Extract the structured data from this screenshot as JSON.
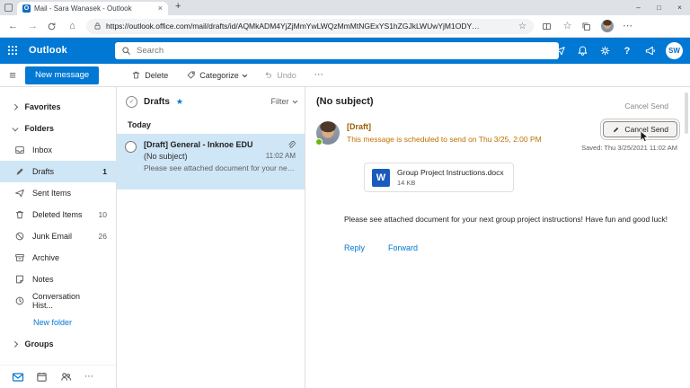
{
  "glyphs": {
    "back": "←",
    "forward": "→",
    "home": "⌂",
    "menu": "≡",
    "ellipsis": "⋯",
    "check": "✓",
    "star_filled": "★",
    "star_outline": "☆",
    "plus": "+",
    "close": "×",
    "minimize": "–",
    "maximize": "□",
    "help": "?",
    "skype_s": "S",
    "word_w": "W",
    "outlook_o": "O"
  },
  "browser": {
    "tab_title": "Mail - Sara Wanasek - Outlook",
    "url": "https://outlook.office.com/mail/drafts/id/AQMkADM4YjZjMmYwLWQzMmMtNGExYS1hZGJkLWUwYjM1ODY…"
  },
  "o365": {
    "app_name": "Outlook",
    "search_placeholder": "Search",
    "avatar_initials": "SW",
    "accent": "#0078d4"
  },
  "command_bar": {
    "new_message": "New message",
    "delete": "Delete",
    "categorize": "Categorize",
    "undo": "Undo"
  },
  "sidebar": {
    "favorites_label": "Favorites",
    "folders_label": "Folders",
    "items": [
      {
        "label": "Inbox",
        "count": ""
      },
      {
        "label": "Drafts",
        "count": "1"
      },
      {
        "label": "Sent Items",
        "count": ""
      },
      {
        "label": "Deleted Items",
        "count": "10"
      },
      {
        "label": "Junk Email",
        "count": "26"
      },
      {
        "label": "Archive",
        "count": ""
      },
      {
        "label": "Notes",
        "count": ""
      },
      {
        "label": "Conversation Hist...",
        "count": ""
      }
    ],
    "new_folder_label": "New folder",
    "groups_label": "Groups"
  },
  "message_list": {
    "title": "Drafts",
    "filter_label": "Filter",
    "today_label": "Today",
    "message": {
      "line1": "[Draft] General - Inknoe EDU",
      "subject": "(No subject)",
      "time": "11:02 AM",
      "preview": "Please see attached document for your next..."
    }
  },
  "reading_pane": {
    "subject": "(No subject)",
    "cancel_send_text": "Cancel Send",
    "cancel_send_button": "Cancel Send",
    "saved_text": "Saved: Thu 3/25/2021 11:02 AM",
    "draft_label": "[Draft]",
    "scheduled_text": "This message is scheduled to send on Thu 3/25, 2:00 PM",
    "attachment_name": "Group Project Instructions.docx",
    "attachment_size": "14 KB",
    "body": "Please see attached document for your next group project instructions! Have fun and good luck!",
    "reply_label": "Reply",
    "forward_label": "Forward"
  }
}
